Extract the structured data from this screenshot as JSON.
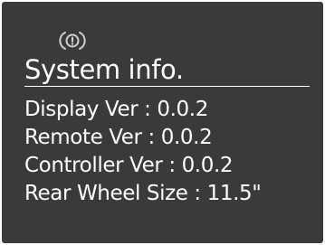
{
  "screen": {
    "warning_icon": "warning-circle-icon",
    "title": "System info.",
    "rows": [
      {
        "text": "Display Ver : 0.0.2"
      },
      {
        "text": "Remote Ver : 0.0.2"
      },
      {
        "text": "Controller Ver : 0.0.2"
      },
      {
        "text": "Rear Wheel Size : 11.5\""
      }
    ]
  },
  "colors": {
    "background": "#3a3a3a",
    "text": "#ffffff",
    "icon": "#cfcfcf"
  }
}
